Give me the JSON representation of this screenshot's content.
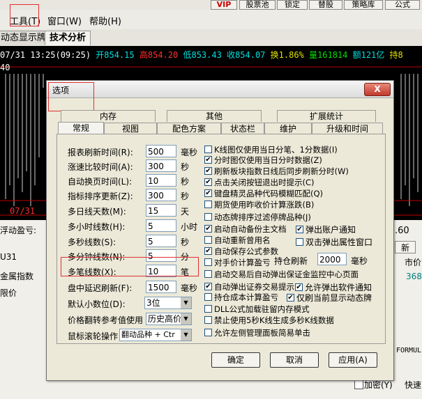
{
  "topbar": {
    "buttons": [
      "VIP",
      "股票池",
      "锁定",
      "替股",
      "策略库",
      "公式"
    ]
  },
  "menu": {
    "tools": "工具(T)",
    "window": "窗口(W)",
    "help": "帮助(H)"
  },
  "tabs": [
    "动态显示牌",
    "技术分析"
  ],
  "chart": {
    "date_time": "07/31 13:25(09:25)",
    "open_label": "开854.15",
    "high_label": "高854.20",
    "low_label": "低853.43",
    "close_label": "收854.07",
    "change_label": "换1.86%",
    "volume_label": "量161814",
    "amount_label": "额121亿",
    "hold_label": "持8",
    "left_value": "40",
    "date_axis": "07/31"
  },
  "bottom": {
    "float_pl": "浮动盈亏:",
    "row_code": "U31",
    "row_gold": "金属指数",
    "row_price": "限价",
    "right_val1": ".60",
    "right_val2": "368",
    "right_btn1": "新",
    "right_btn2": "市价",
    "formul": "FORMUL",
    "lock_label": "加密(Y)",
    "fast_label": "快速"
  },
  "dialog": {
    "title": "选项",
    "close": "X",
    "tabs_row1": [
      "内存",
      "其他",
      "扩展统计"
    ],
    "tabs_row2": [
      "常规",
      "视图",
      "配色方案",
      "状态栏",
      "维护",
      "升级和时间"
    ],
    "settings": [
      {
        "label": "报表刷新时间(R):",
        "value": "500",
        "unit": "毫秒"
      },
      {
        "label": "涨速比较时间(A):",
        "value": "300",
        "unit": "秒"
      },
      {
        "label": "自动换页时间(L):",
        "value": "10",
        "unit": "秒"
      },
      {
        "label": "指标排序更新(Z):",
        "value": "300",
        "unit": "秒"
      },
      {
        "label": "多日线天数(M):",
        "value": "15",
        "unit": "天"
      },
      {
        "label": "多小时线数(H):",
        "value": "5",
        "unit": "小时"
      },
      {
        "label": "多秒线数(S):",
        "value": "5",
        "unit": "秒"
      },
      {
        "label": "多分钟线数(N):",
        "value": "5",
        "unit": "分"
      },
      {
        "label": "多笔线数(X):",
        "value": "10",
        "unit": "笔"
      },
      {
        "label": "盘中延迟刷新(F):",
        "value": "1500",
        "unit": "毫秒"
      }
    ],
    "decimal": {
      "label": "默认小数位(D):",
      "value": "3位"
    },
    "price_ref": {
      "label": "价格翻转参考值使用",
      "value": "历史高价"
    },
    "mouse_wheel": {
      "label": "鼠标滚轮操作",
      "value": "翻动品种 + Ctr"
    },
    "checkboxes": [
      {
        "label": "K线图仅使用当日分笔、1分数据(I)",
        "checked": false
      },
      {
        "label": "分时图仅使用当日分时数据(Z)",
        "checked": true
      },
      {
        "label": "刷新板块指数日线后同步刷新分时(W)",
        "checked": true
      },
      {
        "label": "点击关闭按钮退出时提示(C)",
        "checked": true
      },
      {
        "label": "键盘精灵品种代码模糊匹配(Q)",
        "checked": true
      },
      {
        "label": "期货使用昨收价计算涨跌(B)",
        "checked": false
      },
      {
        "label": "动态牌排序过滤停牌品种(J)",
        "checked": false
      },
      {
        "label": "启动自动备份主文档",
        "checked": true
      },
      {
        "label": "自动重新曾用名",
        "checked": false
      },
      {
        "label": "自动保存公式参数",
        "checked": true
      },
      {
        "label": "对手价计算盈亏",
        "checked": false
      },
      {
        "label": "启动交易后自动弹出保证金监控中心页面",
        "checked": false
      },
      {
        "label": "自动弹出证券交易提示",
        "checked": true
      },
      {
        "label": "持仓成本计算盈亏",
        "checked": false
      },
      {
        "label": "DLL公式加载驻留内存模式",
        "checked": false
      },
      {
        "label": "禁止使用5秒K线生成多秒K线数据",
        "checked": false
      },
      {
        "label": "允许左侧管理面板简易单击",
        "checked": false
      }
    ],
    "side_checks": [
      {
        "label": "弹出账户通知",
        "checked": true
      },
      {
        "label": "双击弹出属性窗口",
        "checked": false
      },
      {
        "label": "允许弹出软件通知",
        "checked": true
      },
      {
        "label": "仅刷当前显示动态牌",
        "checked": true
      }
    ],
    "hold_refresh": {
      "label": "持仓刷新",
      "value": "2000",
      "unit": "毫秒"
    },
    "buttons": {
      "ok": "确定",
      "cancel": "取消",
      "apply": "应用(A)"
    }
  }
}
